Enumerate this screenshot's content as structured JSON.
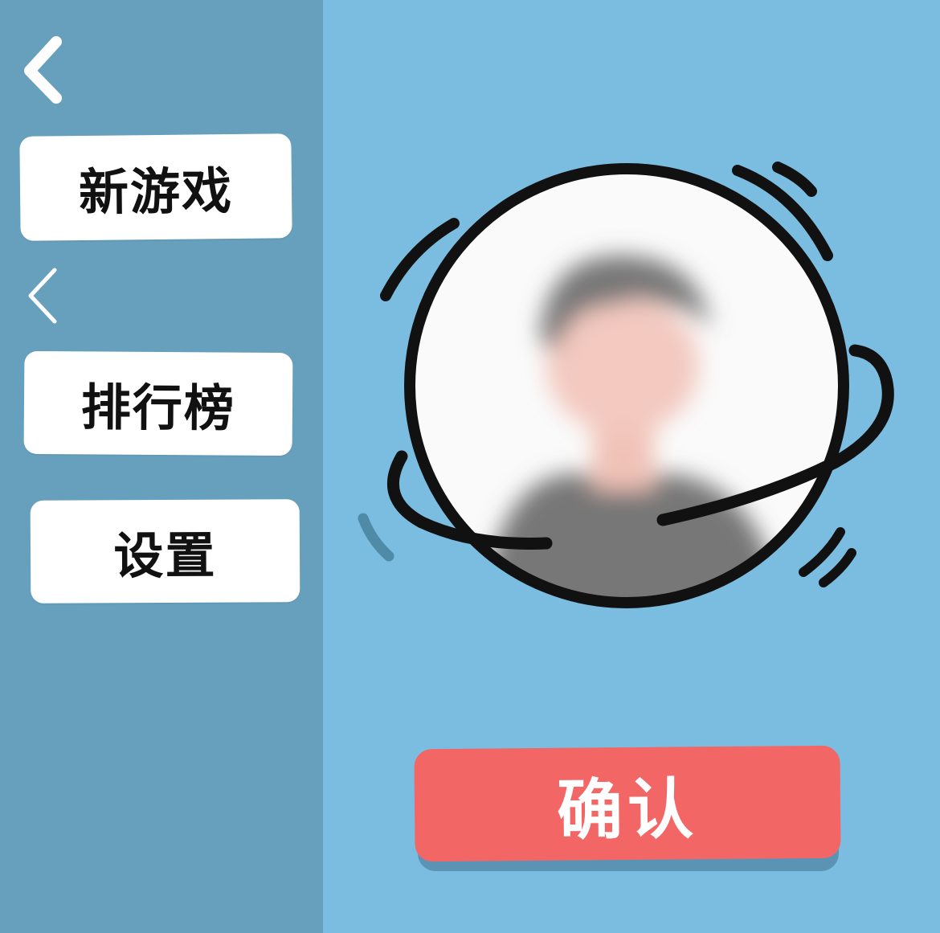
{
  "menu": {
    "back_icon": "chevron-left-icon",
    "collapse_icon": "chevron-left-icon",
    "new_game_label": "新游戏",
    "leaderboard_label": "排行榜",
    "settings_label": "设置"
  },
  "avatar": {
    "icon": "user-avatar-icon"
  },
  "actions": {
    "confirm_label": "确认"
  },
  "colors": {
    "sidebar": "#67a0bd",
    "background": "#7bbde0",
    "confirm": "#f26766",
    "button": "#ffffff"
  }
}
